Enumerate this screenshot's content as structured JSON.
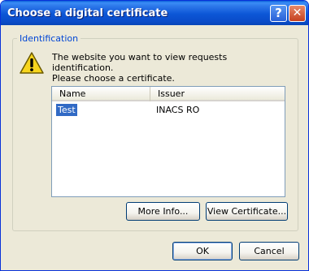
{
  "window": {
    "title": "Choose a digital certificate",
    "help_symbol": "?",
    "close_symbol": "✕"
  },
  "group": {
    "label": "Identification",
    "icon": "warning-icon",
    "message_line1": "The website you want to view requests identification.",
    "message_line2": "Please choose a certificate."
  },
  "certificate_list": {
    "columns": [
      "Name",
      "Issuer"
    ],
    "rows": [
      {
        "name": "Test",
        "issuer": "INACS RO",
        "selected": true
      }
    ]
  },
  "buttons": {
    "more_info": "More Info...",
    "view_certificate": "View Certificate...",
    "ok": "OK",
    "cancel": "Cancel"
  },
  "colors": {
    "titlebar": "#0a4cc9",
    "dialog_bg": "#ece9d8",
    "group_label": "#0046d5",
    "selection": "#316ac5"
  }
}
